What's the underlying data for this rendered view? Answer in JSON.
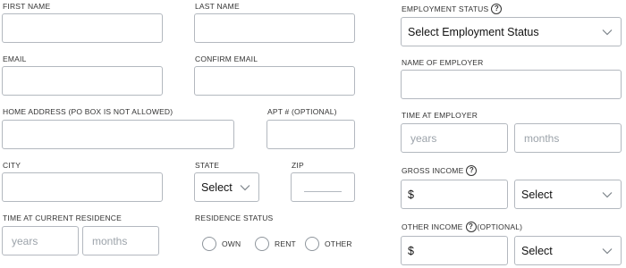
{
  "left": {
    "first_name": {
      "label": "FIRST NAME",
      "value": ""
    },
    "last_name": {
      "label": "LAST NAME",
      "value": ""
    },
    "email": {
      "label": "EMAIL",
      "value": ""
    },
    "confirm_email": {
      "label": "CONFIRM EMAIL",
      "value": ""
    },
    "home_address": {
      "label": "HOME ADDRESS (PO BOX IS NOT ALLOWED)",
      "value": ""
    },
    "apt": {
      "label": "APT # (OPTIONAL)",
      "value": ""
    },
    "city": {
      "label": "CITY",
      "value": ""
    },
    "state": {
      "label": "STATE",
      "selected": "Select"
    },
    "zip": {
      "label": "ZIP",
      "value": ""
    },
    "time_at_residence": {
      "label": "TIME AT CURRENT RESIDENCE",
      "years_placeholder": "years",
      "months_placeholder": "months"
    },
    "residence_status": {
      "label": "RESIDENCE STATUS",
      "options": [
        "OWN",
        "RENT",
        "OTHER"
      ]
    }
  },
  "right": {
    "employment_status": {
      "label": "EMPLOYMENT STATUS",
      "help_icon": "question-circle-icon",
      "selected": "Select Employment Status"
    },
    "employer_name": {
      "label": "NAME OF EMPLOYER",
      "value": ""
    },
    "time_at_employer": {
      "label": "TIME AT EMPLOYER",
      "years_placeholder": "years",
      "months_placeholder": "months"
    },
    "gross_income": {
      "label": "GROSS INCOME",
      "help_icon": "question-circle-icon",
      "currency": "$",
      "frequency_selected": "Select"
    },
    "other_income": {
      "label": "OTHER INCOME",
      "optional_suffix": "(OPTIONAL)",
      "help_icon": "question-circle-icon",
      "currency": "$",
      "frequency_selected": "Select"
    }
  },
  "colors": {
    "border": "#b3b8bf",
    "label": "#333333",
    "placeholder": "#9ca3aa"
  }
}
